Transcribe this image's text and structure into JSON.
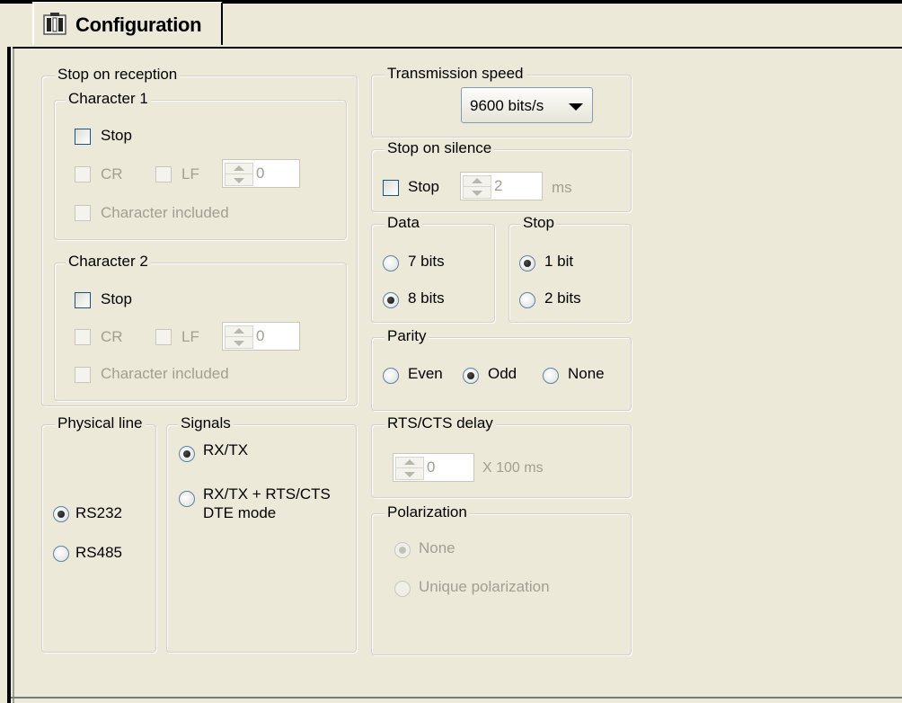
{
  "tab": {
    "label": "Configuration",
    "icon": "config-module-icon"
  },
  "stop_on_reception": {
    "title": "Stop on reception",
    "character1": {
      "title": "Character 1",
      "stop": "Stop",
      "cr": "CR",
      "lf": "LF",
      "value": "0",
      "included": "Character included"
    },
    "character2": {
      "title": "Character 2",
      "stop": "Stop",
      "cr": "CR",
      "lf": "LF",
      "value": "0",
      "included": "Character included"
    }
  },
  "physical_line": {
    "title": "Physical line",
    "rs232": "RS232",
    "rs485": "RS485",
    "selected": "RS232"
  },
  "signals": {
    "title": "Signals",
    "rxtx": "RX/TX",
    "rxtx_rts_line1": "RX/TX + RTS/CTS",
    "rxtx_rts_line2": "DTE mode",
    "selected": "RX/TX"
  },
  "transmission_speed": {
    "title": "Transmission speed",
    "value": "9600 bits/s"
  },
  "stop_on_silence": {
    "title": "Stop on silence",
    "stop": "Stop",
    "value": "2",
    "unit": "ms"
  },
  "data": {
    "title": "Data",
    "opt1": "7 bits",
    "opt2": "8 bits",
    "selected": "8 bits"
  },
  "stop_bits": {
    "title": "Stop",
    "opt1": "1 bit",
    "opt2": "2 bits",
    "selected": "1 bit"
  },
  "parity": {
    "title": "Parity",
    "even": "Even",
    "odd": "Odd",
    "none": "None",
    "selected": "Odd"
  },
  "rts_cts_delay": {
    "title": "RTS/CTS delay",
    "value": "0",
    "unit": "X 100 ms"
  },
  "polarization": {
    "title": "Polarization",
    "none": "None",
    "unique": "Unique polarization",
    "selected": "None"
  },
  "colors": {
    "background": "#ece9d8",
    "disabled_text": "#a19f91",
    "border": "#d4d0c8"
  }
}
